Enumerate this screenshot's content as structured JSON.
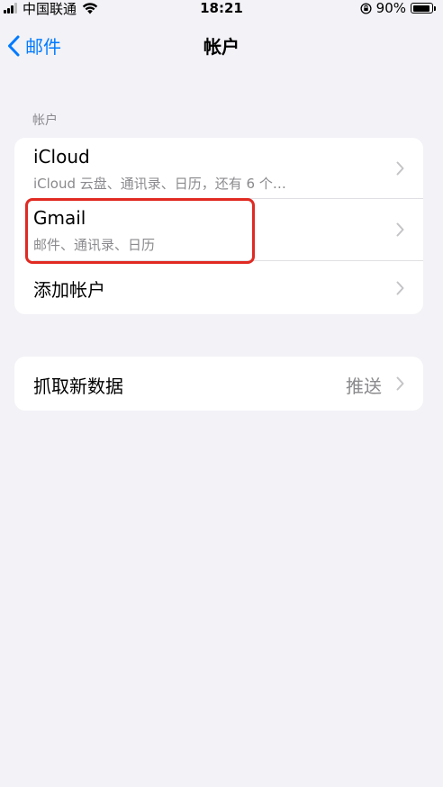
{
  "status_bar": {
    "carrier": "中国联通",
    "time": "18:21",
    "battery_text": "90%",
    "battery_level": 0.9,
    "icons": [
      "signal-icon",
      "wifi-icon",
      "orientation-lock-icon",
      "battery-icon"
    ]
  },
  "nav": {
    "back_label": "邮件",
    "title": "帐户"
  },
  "accounts_section": {
    "header": "帐户",
    "rows": [
      {
        "title": "iCloud",
        "subtitle": "iCloud 云盘、通讯录、日历，还有 6 个…"
      },
      {
        "title": "Gmail",
        "subtitle": "邮件、通讯录、日历"
      },
      {
        "title": "添加帐户"
      }
    ]
  },
  "fetch_section": {
    "title": "抓取新数据",
    "value": "推送"
  },
  "colors": {
    "accent": "#007aff",
    "background": "#f2f2f7",
    "highlight": "#e02a22",
    "secondary_text": "#8a8a8e"
  }
}
